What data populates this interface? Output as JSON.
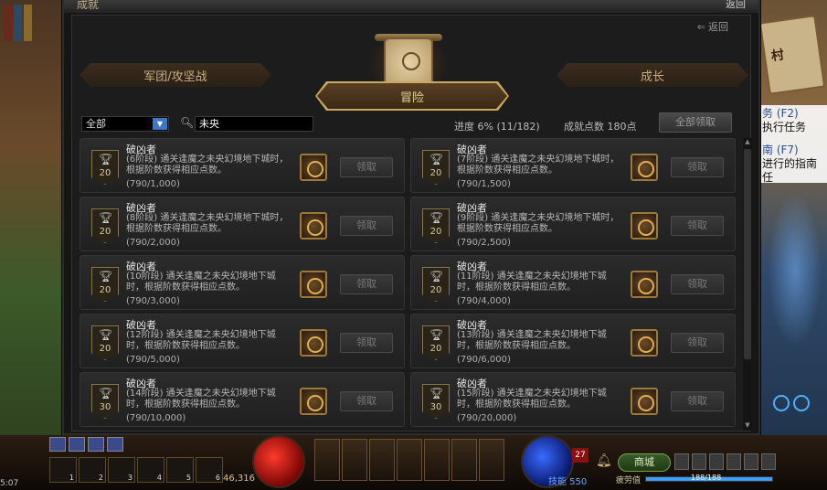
{
  "window": {
    "title": "成就",
    "close_label": "返回",
    "back_label": "返回"
  },
  "tabs": {
    "left": "军团/攻坚战",
    "active": "冒险",
    "right": "成长"
  },
  "filter": {
    "category_value": "全部",
    "search_value": "未央"
  },
  "progress": {
    "label": "进度 6% (11/182)",
    "percent": 6,
    "done": 11,
    "total": 182,
    "points_label": "成就点数 180点",
    "claim_all_label": "全部领取"
  },
  "achievements": [
    {
      "name": "破凶者",
      "points": "20",
      "desc": "(6阶段) 通关逢魔之未央幻境地下城时，根据阶数获得相应点数。",
      "progress": "(790/1,000)",
      "claim": "领取"
    },
    {
      "name": "破凶者",
      "points": "20",
      "desc": "(7阶段) 通关逢魔之未央幻境地下城时，根据阶数获得相应点数。",
      "progress": "(790/1,500)",
      "claim": "领取"
    },
    {
      "name": "破凶者",
      "points": "20",
      "desc": "(8阶段) 通关逢魔之未央幻境地下城时，根据阶数获得相应点数。",
      "progress": "(790/2,000)",
      "claim": "领取"
    },
    {
      "name": "破凶者",
      "points": "20",
      "desc": "(9阶段) 通关逢魔之未央幻境地下城时，根据阶数获得相应点数。",
      "progress": "(790/2,500)",
      "claim": "领取"
    },
    {
      "name": "破凶者",
      "points": "20",
      "desc": "(10阶段) 通关逢魔之未央幻境地下城时，根据阶数获得相应点数。",
      "progress": "(790/3,000)",
      "claim": "领取"
    },
    {
      "name": "破凶者",
      "points": "20",
      "desc": "(11阶段) 通关逢魔之未央幻境地下城时，根据阶数获得相应点数。",
      "progress": "(790/4,000)",
      "claim": "领取"
    },
    {
      "name": "破凶者",
      "points": "20",
      "desc": "(12阶段) 通关逢魔之未央幻境地下城时，根据阶数获得相应点数。",
      "progress": "(790/5,000)",
      "claim": "领取"
    },
    {
      "name": "破凶者",
      "points": "20",
      "desc": "(13阶段) 通关逢魔之未央幻境地下城时，根据阶数获得相应点数。",
      "progress": "(790/6,000)",
      "claim": "领取"
    },
    {
      "name": "破凶者",
      "points": "30",
      "desc": "(14阶段) 通关逢魔之未央幻境地下城时，根据阶数获得相应点数。",
      "progress": "(790/10,000)",
      "claim": "领取"
    },
    {
      "name": "破凶者",
      "points": "30",
      "desc": "(15阶段) 通关逢魔之未央幻境地下城时，根据阶数获得相应点数。",
      "progress": "(790/20,000)",
      "claim": "领取"
    }
  ],
  "side": {
    "sign": "村",
    "quest1_key": "务 (F2)",
    "quest1_text": "执行任务",
    "quest2_key": "南 (F7)",
    "quest2_text": "进行的指南任"
  },
  "hud": {
    "gold": "46,316",
    "skill_points": "技能 550",
    "level": "27",
    "shop": "商城",
    "fatigue_label": "疲劳值",
    "fatigue_text": "188/188",
    "fatigue_fraction": 1.0,
    "time": "5:07",
    "quickslot_keys": [
      "1",
      "2",
      "3",
      "4",
      "5",
      "6"
    ]
  },
  "colors": {
    "accent_gold": "#caa85e",
    "panel_bg": "#1c1c1c",
    "search_blue": "#3f76c6"
  }
}
